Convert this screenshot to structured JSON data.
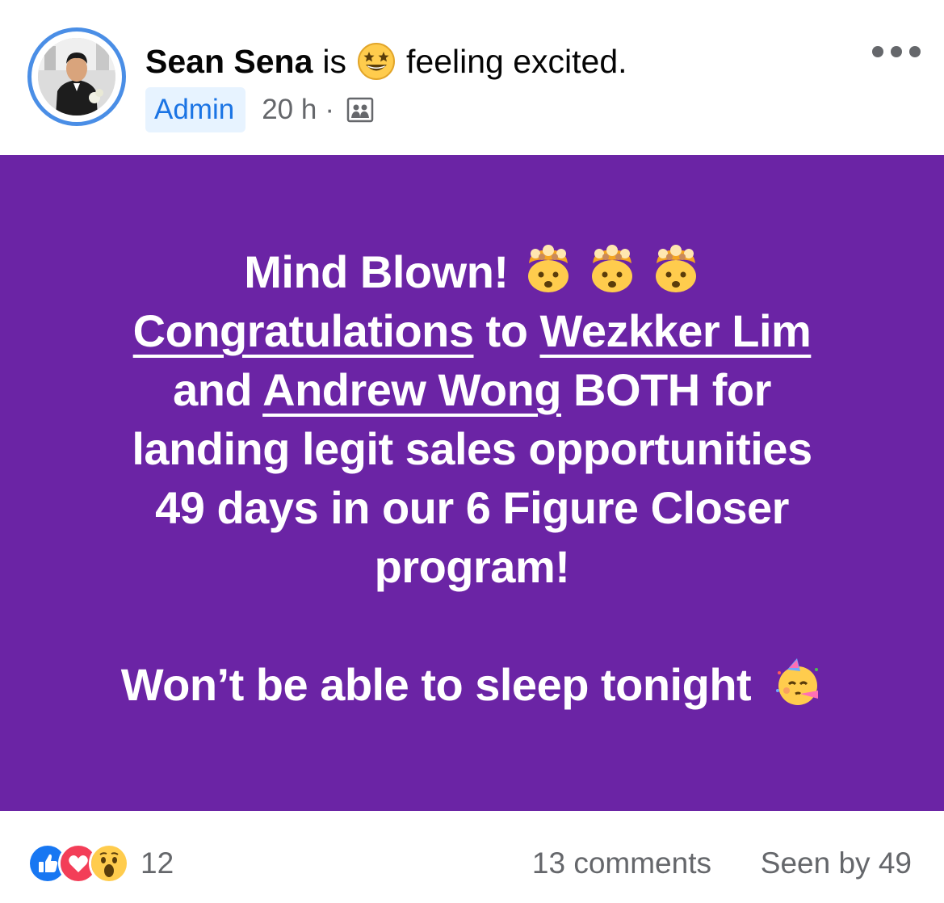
{
  "post": {
    "author_name": "Sean Sena",
    "feeling_prefix": "is",
    "feeling_emoji": "star-struck-emoji",
    "feeling_text": "feeling excited.",
    "badge": "Admin",
    "time": "20 h",
    "separator": "·",
    "audience_icon": "group-members-icon",
    "menu_icon": "more-options-icon"
  },
  "card": {
    "background": "#6b24a5",
    "text_color": "#ffffff",
    "line1": "Mind Blown!",
    "line1_emoji": "exploding-head-emoji",
    "line2": {
      "mention1": "Congratulations",
      "middle": " to ",
      "mention2": "Wezkker Lim"
    },
    "line3": {
      "start": "and ",
      "mention": "Andrew Wong",
      "end": " BOTH for"
    },
    "line4": "landing legit sales opportunities",
    "line5": "49 days in our 6 Figure Closer",
    "line6": "program!",
    "line7": "Won’t be able to sleep tonight",
    "line7_emoji": "partying-face-emoji"
  },
  "footer": {
    "reaction_icons": [
      "like-icon",
      "love-icon",
      "wow-icon"
    ],
    "reaction_count": "12",
    "comments": "13 comments",
    "seen_by": "Seen by 49"
  },
  "colors": {
    "admin_badge_bg": "#e7f3ff",
    "admin_badge_text": "#1b74e4",
    "secondary_text": "#65676b",
    "avatar_ring": "#4a8ee6"
  }
}
